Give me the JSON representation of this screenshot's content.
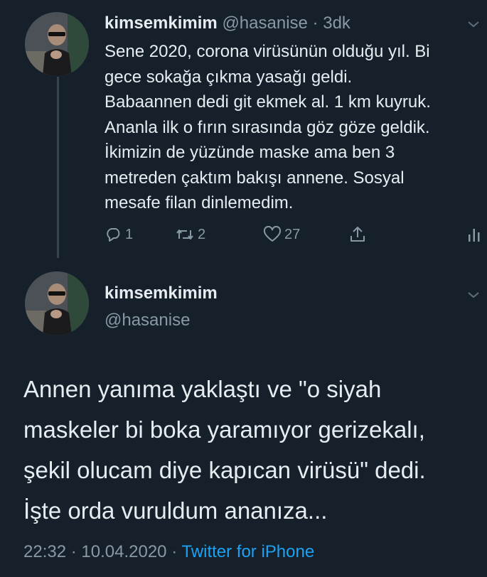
{
  "tweet1": {
    "name": "kimsemkimim",
    "handle": "@hasanise",
    "separator": "·",
    "time": "3dk",
    "text": "Sene 2020, corona virüsünün olduğu yıl. Bi\ngece sokağa çıkma yasağı geldi.\nBabaannen dedi git ekmek al. 1 km kuyruk.\nAnanla ilk o fırın sırasında göz göze geldik.\nİkimizin de yüzünde maske ama ben 3\nmetreden çaktım bakışı annene. Sosyal\nmesafe filan dinlemedim.",
    "reply_count": "1",
    "retweet_count": "2",
    "like_count": "27"
  },
  "tweet2": {
    "name": "kimsemkimim",
    "handle": "@hasanise",
    "text": "Annen yanıma yaklaştı ve \"o siyah\nmaskeler bi boka yaramıyor gerizekalı,\nşekil olucam diye kapıcan virüsü\" dedi.\nİşte orda vuruldum ananıza...",
    "time": "22:32",
    "separator": "·",
    "date": "10.04.2020",
    "source": "Twitter for iPhone"
  },
  "colors": {
    "background": "#15202b",
    "text": "#e6ecf0",
    "secondary": "#8899a6",
    "link": "#1da1f2",
    "thread_line": "#38444d"
  },
  "icons": {
    "reply": "reply-icon",
    "retweet": "retweet-icon",
    "like": "heart-icon",
    "share": "share-icon",
    "analytics": "analytics-icon",
    "more": "chevron-down-icon"
  }
}
